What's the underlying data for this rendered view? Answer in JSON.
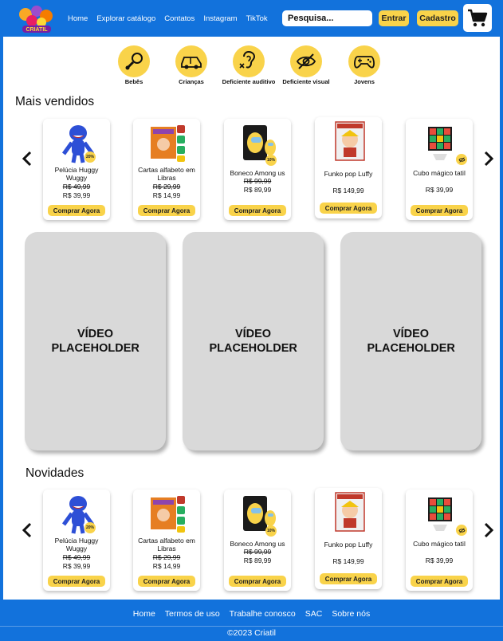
{
  "header": {
    "logo_text": "CRIATIL",
    "nav": [
      "Home",
      "Explorar catálogo",
      "Contatos",
      "Instagram",
      "TikTok"
    ],
    "search_placeholder": "Pesquisa...",
    "login_label": "Entrar",
    "signup_label": "Cadastro",
    "cart_icon": "cart-icon"
  },
  "categories": [
    {
      "label": "Bebês",
      "icon": "rattle-icon"
    },
    {
      "label": "Crianças",
      "icon": "car-icon"
    },
    {
      "label": "Deficiente auditivo",
      "icon": "ear-icon"
    },
    {
      "label": "Deficiente visual",
      "icon": "eye-slash-icon"
    },
    {
      "label": "Jovens",
      "icon": "gamepad-icon"
    }
  ],
  "best_sellers": {
    "title": "Mais vendidos",
    "products": [
      {
        "name": "Pelúcia Huggy Wuggy",
        "old_price": "R$ 49,99",
        "price": "R$ 39,99",
        "badge": "20%",
        "buy": "Comprar Agora"
      },
      {
        "name": "Cartas alfabeto em Libras",
        "old_price": "R$ 29,99",
        "price": "R$ 14,99",
        "badge": "",
        "buy": "Comprar Agora"
      },
      {
        "name": "Boneco Among us",
        "old_price": "R$ 99,99",
        "price": "R$ 89,99",
        "badge": "10%",
        "buy": "Comprar Agora"
      },
      {
        "name": "Funko pop Luffy",
        "old_price": "",
        "price": "R$ 149,99",
        "badge": "",
        "buy": "Comprar Agora"
      },
      {
        "name": "Cubo mágico tatil",
        "old_price": "",
        "price": "R$ 39,99",
        "badge": "",
        "buy": "Comprar Agora"
      }
    ]
  },
  "videos": [
    "VÍDEO PLACEHOLDER",
    "VÍDEO PLACEHOLDER",
    "VÍDEO PLACEHOLDER"
  ],
  "new_arrivals": {
    "title": "Novidades",
    "products": [
      {
        "name": "Pelúcia Huggy Wuggy",
        "old_price": "R$ 49,99",
        "price": "R$ 39,99",
        "badge": "20%",
        "buy": "Comprar Agora"
      },
      {
        "name": "Cartas alfabeto em Libras",
        "old_price": "R$ 29,99",
        "price": "R$ 14,99",
        "badge": "",
        "buy": "Comprar Agora"
      },
      {
        "name": "Boneco Among us",
        "old_price": "R$ 99,99",
        "price": "R$ 89,99",
        "badge": "10%",
        "buy": "Comprar Agora"
      },
      {
        "name": "Funko pop Luffy",
        "old_price": "",
        "price": "R$ 149,99",
        "badge": "",
        "buy": "Comprar Agora"
      },
      {
        "name": "Cubo mágico tatil",
        "old_price": "",
        "price": "R$ 39,99",
        "badge": "",
        "buy": "Comprar Agora"
      }
    ]
  },
  "footer": {
    "links": [
      "Home",
      "Termos de uso",
      "Trabalhe conosco",
      "SAC",
      "Sobre nós"
    ],
    "copyright": "©2023 Criatil"
  },
  "colors": {
    "primary": "#1272dc",
    "accent": "#f9d34a",
    "video_bg": "#d9d9d9"
  }
}
